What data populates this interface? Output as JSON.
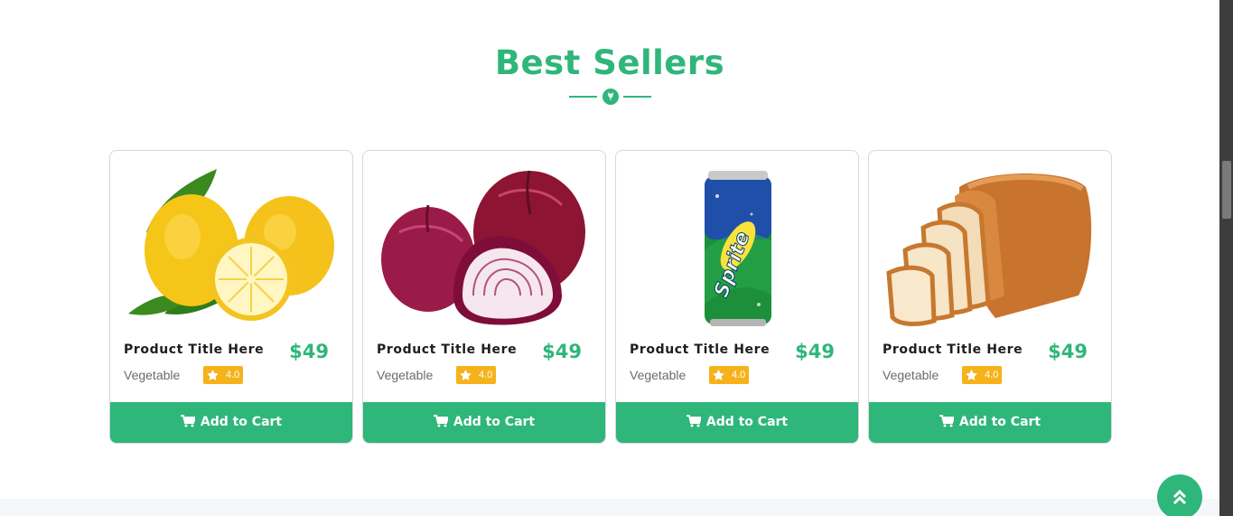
{
  "section": {
    "title": "Best Sellers"
  },
  "products": [
    {
      "title": "Product Title Here",
      "price": "$49",
      "category": "Vegetable",
      "rating": "4.0",
      "cart_label": "Add to Cart",
      "image": "lemons"
    },
    {
      "title": "Product Title Here",
      "price": "$49",
      "category": "Vegetable",
      "rating": "4.0",
      "cart_label": "Add to Cart",
      "image": "red-onions"
    },
    {
      "title": "Product Title Here",
      "price": "$49",
      "category": "Vegetable",
      "rating": "4.0",
      "cart_label": "Add to Cart",
      "image": "sprite-can"
    },
    {
      "title": "Product Title Here",
      "price": "$49",
      "category": "Vegetable",
      "rating": "4.0",
      "cart_label": "Add to Cart",
      "image": "sliced-bread"
    }
  ],
  "icons": {
    "divider": "leaf-icon",
    "rating": "star-icon",
    "cart": "cart-icon",
    "scroll_top": "double-chevron-up-icon"
  },
  "colors": {
    "accent": "#2fb67a",
    "rating_badge": "#f6b21b"
  }
}
